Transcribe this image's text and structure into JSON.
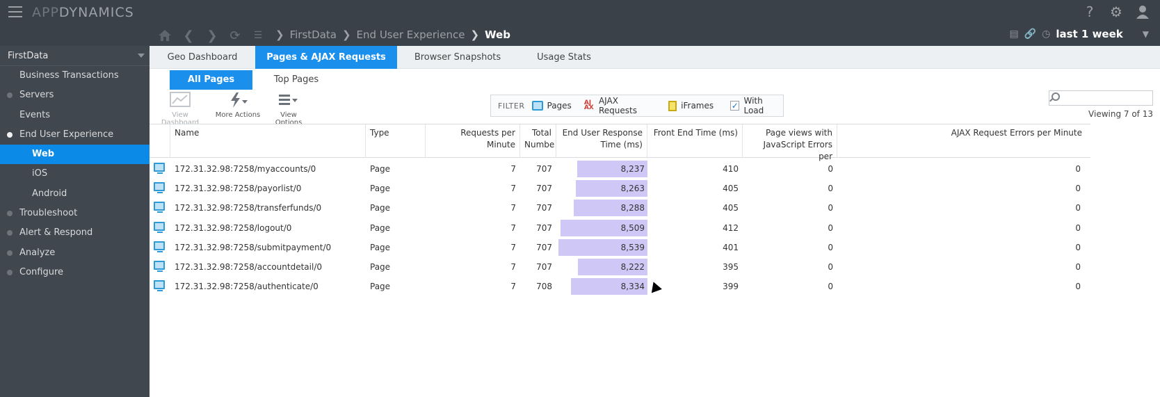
{
  "app": {
    "logo_thin": "APP",
    "logo_bold": "DYNAMICS",
    "top_icons": [
      "help-icon",
      "gear-icon",
      "user-icon"
    ]
  },
  "breadcrumb": {
    "items": [
      "FirstData",
      "End User Experience"
    ],
    "current": "Web"
  },
  "time_range": {
    "label": "last 1 week"
  },
  "sidebar": {
    "application": "FirstData",
    "items": [
      {
        "label": "Business Transactions"
      },
      {
        "label": "Servers"
      },
      {
        "label": "Events"
      },
      {
        "label": "End User Experience"
      },
      {
        "label": "Web"
      },
      {
        "label": "iOS"
      },
      {
        "label": "Android"
      },
      {
        "label": "Troubleshoot"
      },
      {
        "label": "Alert & Respond"
      },
      {
        "label": "Analyze"
      },
      {
        "label": "Configure"
      }
    ]
  },
  "tabs": [
    {
      "label": "Geo Dashboard"
    },
    {
      "label": "Pages & AJAX Requests"
    },
    {
      "label": "Browser Snapshots"
    },
    {
      "label": "Usage Stats"
    }
  ],
  "subtabs": [
    {
      "label": "All Pages"
    },
    {
      "label": "Top Pages"
    }
  ],
  "toolbar": {
    "view_dashboard": "View Dashboard",
    "more_actions": "More Actions",
    "view_options": "View Options"
  },
  "filter": {
    "label": "FILTER",
    "pages": "Pages",
    "ajax": "AJAX Requests",
    "iframes": "iFrames",
    "with_load": "With Load",
    "with_load_checked": true
  },
  "search": {
    "placeholder": ""
  },
  "viewing": "Viewing 7 of 13",
  "table": {
    "headers": {
      "name": "Name",
      "type": "Type",
      "rpm": "Requests per Minute",
      "total": "Total Numbe",
      "eurt": "End User Response Time (ms)",
      "fet": "Front End Time (ms)",
      "jserr": "Page views with JavaScript Errors per",
      "ajaxerr": "AJAX Request Errors per Minute"
    },
    "rows": [
      {
        "name": "172.31.32.98:7258/myaccounts/0",
        "type": "Page",
        "rpm": "7",
        "total": "707",
        "eurt": "8,237",
        "eurt_value": 8237,
        "fet": "410",
        "jserr": "0",
        "ajaxerr": "0"
      },
      {
        "name": "172.31.32.98:7258/payorlist/0",
        "type": "Page",
        "rpm": "7",
        "total": "707",
        "eurt": "8,263",
        "eurt_value": 8263,
        "fet": "405",
        "jserr": "0",
        "ajaxerr": "0"
      },
      {
        "name": "172.31.32.98:7258/transferfunds/0",
        "type": "Page",
        "rpm": "7",
        "total": "707",
        "eurt": "8,288",
        "eurt_value": 8288,
        "fet": "405",
        "jserr": "0",
        "ajaxerr": "0"
      },
      {
        "name": "172.31.32.98:7258/logout/0",
        "type": "Page",
        "rpm": "7",
        "total": "707",
        "eurt": "8,509",
        "eurt_value": 8509,
        "fet": "412",
        "jserr": "0",
        "ajaxerr": "0"
      },
      {
        "name": "172.31.32.98:7258/submitpayment/0",
        "type": "Page",
        "rpm": "7",
        "total": "707",
        "eurt": "8,539",
        "eurt_value": 8539,
        "fet": "401",
        "jserr": "0",
        "ajaxerr": "0"
      },
      {
        "name": "172.31.32.98:7258/accountdetail/0",
        "type": "Page",
        "rpm": "7",
        "total": "707",
        "eurt": "8,222",
        "eurt_value": 8222,
        "fet": "395",
        "jserr": "0",
        "ajaxerr": "0"
      },
      {
        "name": "172.31.32.98:7258/authenticate/0",
        "type": "Page",
        "rpm": "7",
        "total": "708",
        "eurt": "8,334",
        "eurt_value": 8334,
        "fet": "399",
        "jserr": "0",
        "ajaxerr": "0"
      }
    ]
  },
  "colors": {
    "accent": "#1a90ec",
    "bar": "#cfc8f7",
    "topbar": "#3b4149",
    "sidebar": "#41474e"
  }
}
